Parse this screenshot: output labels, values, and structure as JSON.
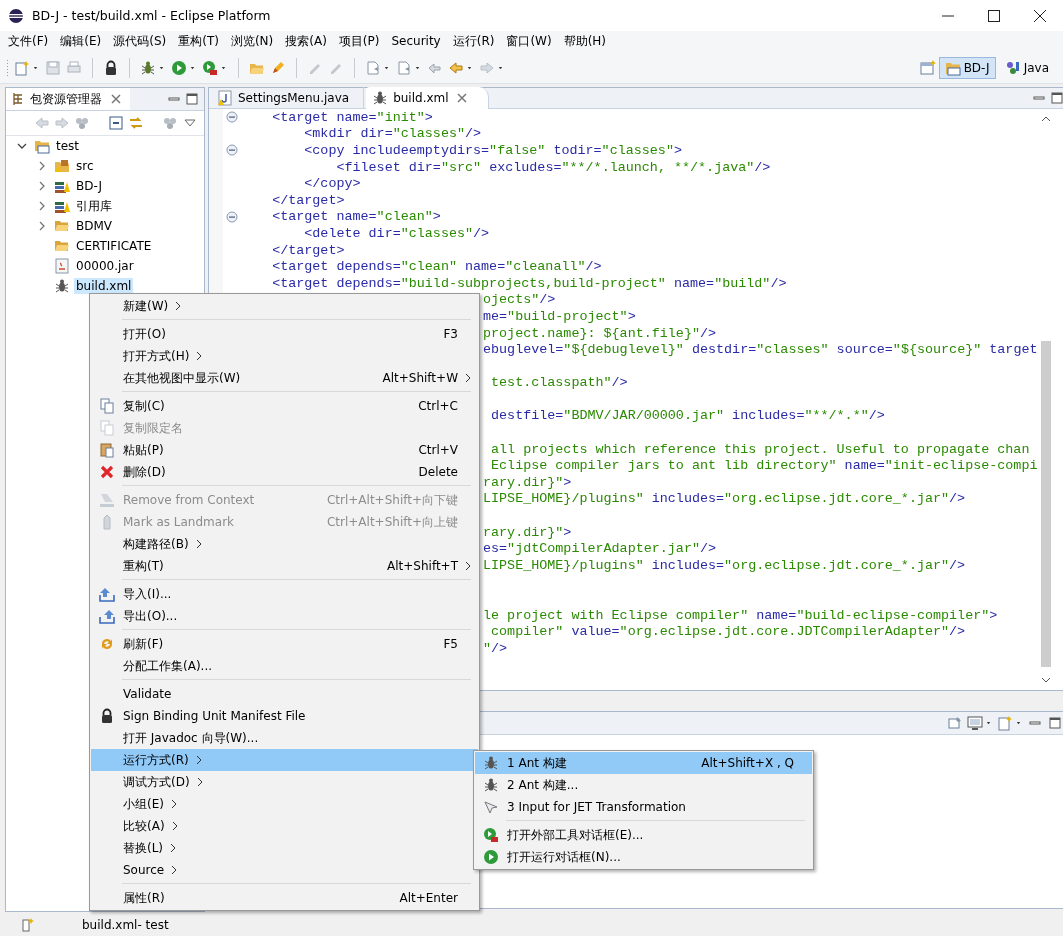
{
  "window": {
    "title": "BD-J  -  test/build.xml  -  Eclipse Platform"
  },
  "menubar": [
    "文件(F)",
    "编辑(E)",
    "源代码(S)",
    "重构(T)",
    "浏览(N)",
    "搜索(A)",
    "项目(P)",
    "Security",
    "运行(R)",
    "窗口(W)",
    "帮助(H)"
  ],
  "perspectives": [
    {
      "label": "BD-J",
      "selected": true
    },
    {
      "label": "Java",
      "selected": false
    }
  ],
  "explorer": {
    "title": "包资源管理器",
    "tree": [
      {
        "label": "test",
        "kind": "project",
        "expanded": true,
        "selected": false,
        "children": [
          {
            "label": "src",
            "kind": "source",
            "expanded": false,
            "selected": false
          },
          {
            "label": "BD-J",
            "kind": "library",
            "expanded": false,
            "selected": false
          },
          {
            "label": "引用库",
            "kind": "library",
            "expanded": false,
            "selected": false
          },
          {
            "label": "BDMV",
            "kind": "folder",
            "expanded": false,
            "selected": false
          },
          {
            "label": "CERTIFICATE",
            "kind": "folder",
            "selected": false
          },
          {
            "label": "00000.jar",
            "kind": "jar",
            "selected": false
          },
          {
            "label": "build.xml",
            "kind": "xml",
            "selected": true
          }
        ]
      }
    ]
  },
  "editor": {
    "tabs": [
      {
        "label": "SettingsMenu.java",
        "kind": "java",
        "selected": false
      },
      {
        "label": "build.xml",
        "kind": "xml",
        "selected": true
      }
    ],
    "lines": [
      {
        "kind": "full",
        "collapsible": true,
        "segments": [
          {
            "kind": "markup",
            "text": "    <target name="
          },
          {
            "kind": "value",
            "text": "\"init\""
          },
          {
            "kind": "markup",
            "text": ">"
          }
        ]
      },
      {
        "kind": "full",
        "segments": [
          {
            "kind": "markup",
            "text": "        <mkdir dir="
          },
          {
            "kind": "value",
            "text": "\"classes\""
          },
          {
            "kind": "markup",
            "text": "/>"
          }
        ]
      },
      {
        "kind": "full",
        "collapsible": true,
        "segments": [
          {
            "kind": "markup",
            "text": "        <copy includeemptydirs="
          },
          {
            "kind": "value",
            "text": "\"false\""
          },
          {
            "kind": "markup",
            "text": " todir="
          },
          {
            "kind": "value",
            "text": "\"classes\""
          },
          {
            "kind": "markup",
            "text": ">"
          }
        ]
      },
      {
        "kind": "full",
        "segments": [
          {
            "kind": "markup",
            "text": "            <fileset dir="
          },
          {
            "kind": "value",
            "text": "\"src\""
          },
          {
            "kind": "markup",
            "text": " excludes="
          },
          {
            "kind": "value",
            "text": "\"**/*.launch, **/*.java\""
          },
          {
            "kind": "markup",
            "text": "/>"
          }
        ]
      },
      {
        "kind": "full",
        "segments": [
          {
            "kind": "markup",
            "text": "        </copy>"
          }
        ]
      },
      {
        "kind": "full",
        "segments": [
          {
            "kind": "markup",
            "text": "    </target>"
          }
        ]
      },
      {
        "kind": "full",
        "collapsible": true,
        "segments": [
          {
            "kind": "markup",
            "text": "    <target name="
          },
          {
            "kind": "value",
            "text": "\"clean\""
          },
          {
            "kind": "markup",
            "text": ">"
          }
        ]
      },
      {
        "kind": "full",
        "segments": [
          {
            "kind": "markup",
            "text": "        <delete dir="
          },
          {
            "kind": "value",
            "text": "\"classes\""
          },
          {
            "kind": "markup",
            "text": "/>"
          }
        ]
      },
      {
        "kind": "full",
        "segments": [
          {
            "kind": "markup",
            "text": "    </target>"
          }
        ]
      },
      {
        "kind": "full",
        "segments": [
          {
            "kind": "markup",
            "text": "    <target depends="
          },
          {
            "kind": "value",
            "text": "\"clean\""
          },
          {
            "kind": "markup",
            "text": " name="
          },
          {
            "kind": "value",
            "text": "\"cleanall\""
          },
          {
            "kind": "markup",
            "text": "/>"
          }
        ]
      },
      {
        "kind": "full",
        "segments": [
          {
            "kind": "markup",
            "text": "    <target depends="
          },
          {
            "kind": "value",
            "text": "\"build-subprojects,build-project\""
          },
          {
            "kind": "markup",
            "text": " name="
          },
          {
            "kind": "value",
            "text": "\"build\""
          },
          {
            "kind": "markup",
            "text": "/>"
          }
        ]
      },
      {
        "kind": "fragment",
        "segments": [
          {
            "kind": "value",
            "text": "ojects\""
          },
          {
            "kind": "markup",
            "text": "/>"
          }
        ]
      },
      {
        "kind": "fragment",
        "segments": [
          {
            "kind": "markup",
            "text": "me="
          },
          {
            "kind": "value",
            "text": "\"build-project\""
          },
          {
            "kind": "markup",
            "text": ">"
          }
        ]
      },
      {
        "kind": "fragment",
        "segments": [
          {
            "kind": "value",
            "text": "project.name}: ${ant.file}\""
          },
          {
            "kind": "markup",
            "text": "/>"
          }
        ]
      },
      {
        "kind": "fragment",
        "segments": [
          {
            "kind": "markup",
            "text": "ebuglevel="
          },
          {
            "kind": "value",
            "text": "\"${debuglevel}\""
          },
          {
            "kind": "markup",
            "text": " destdir="
          },
          {
            "kind": "value",
            "text": "\"classes\""
          },
          {
            "kind": "markup",
            "text": " source="
          },
          {
            "kind": "value",
            "text": "\"${source}\""
          },
          {
            "kind": "markup",
            "text": " target"
          }
        ]
      },
      {
        "kind": "blank"
      },
      {
        "kind": "fragment",
        "segments": [
          {
            "kind": "value",
            "text": " test.classpath\""
          },
          {
            "kind": "markup",
            "text": "/>"
          }
        ]
      },
      {
        "kind": "blank"
      },
      {
        "kind": "fragment",
        "segments": [
          {
            "kind": "markup",
            "text": " destfile="
          },
          {
            "kind": "value",
            "text": "\"BDMV/JAR/00000.jar\""
          },
          {
            "kind": "markup",
            "text": " includes="
          },
          {
            "kind": "value",
            "text": "\"**/*.*\""
          },
          {
            "kind": "markup",
            "text": "/>"
          }
        ]
      },
      {
        "kind": "blank"
      },
      {
        "kind": "fragment",
        "segments": [
          {
            "kind": "value",
            "text": " all projects which reference this project. Useful to propagate chan"
          }
        ]
      },
      {
        "kind": "fragment",
        "segments": [
          {
            "kind": "value",
            "text": " Eclipse compiler jars to ant lib directory\""
          },
          {
            "kind": "markup",
            "text": " name="
          },
          {
            "kind": "value",
            "text": "\"init-eclipse-compi"
          }
        ]
      },
      {
        "kind": "fragment",
        "segments": [
          {
            "kind": "value",
            "text": "rary.dir}\""
          },
          {
            "kind": "markup",
            "text": ">"
          }
        ]
      },
      {
        "kind": "fragment",
        "segments": [
          {
            "kind": "value",
            "text": "LIPSE_HOME}/plugins\""
          },
          {
            "kind": "markup",
            "text": " includes="
          },
          {
            "kind": "value",
            "text": "\"org.eclipse.jdt.core_*.jar\""
          },
          {
            "kind": "markup",
            "text": "/>"
          }
        ]
      },
      {
        "kind": "blank"
      },
      {
        "kind": "fragment",
        "segments": [
          {
            "kind": "value",
            "text": "rary.dir}\""
          },
          {
            "kind": "markup",
            "text": ">"
          }
        ]
      },
      {
        "kind": "fragment",
        "segments": [
          {
            "kind": "markup",
            "text": "es="
          },
          {
            "kind": "value",
            "text": "\"jdtCompilerAdapter.jar\""
          },
          {
            "kind": "markup",
            "text": "/>"
          }
        ]
      },
      {
        "kind": "fragment",
        "segments": [
          {
            "kind": "value",
            "text": "LIPSE_HOME}/plugins\""
          },
          {
            "kind": "markup",
            "text": " includes="
          },
          {
            "kind": "value",
            "text": "\"org.eclipse.jdt.core_*.jar\""
          },
          {
            "kind": "markup",
            "text": "/>"
          }
        ]
      },
      {
        "kind": "blank"
      },
      {
        "kind": "blank"
      },
      {
        "kind": "fragment",
        "segments": [
          {
            "kind": "value",
            "text": "le project with Eclipse compiler\""
          },
          {
            "kind": "markup",
            "text": " name="
          },
          {
            "kind": "value",
            "text": "\"build-eclipse-compiler\""
          },
          {
            "kind": "markup",
            "text": ">"
          }
        ]
      },
      {
        "kind": "fragment",
        "segments": [
          {
            "kind": "value",
            "text": " compiler\""
          },
          {
            "kind": "markup",
            "text": " value="
          },
          {
            "kind": "value",
            "text": "\"org.eclipse.jdt.core.JDTCompilerAdapter\""
          },
          {
            "kind": "markup",
            "text": "/>"
          }
        ]
      },
      {
        "kind": "fragment",
        "segments": [
          {
            "kind": "value",
            "text": "\""
          },
          {
            "kind": "markup",
            "text": "/>"
          }
        ]
      }
    ]
  },
  "context_menu": {
    "groups": [
      [
        {
          "label": "新建(W)",
          "submenu": true,
          "disabled": false,
          "selected": false
        }
      ],
      [
        {
          "label": "打开(O)",
          "shortcut": "F3",
          "submenu": false,
          "disabled": false,
          "selected": false
        },
        {
          "label": "打开方式(H)",
          "submenu": true,
          "disabled": false,
          "selected": false
        },
        {
          "label": "在其他视图中显示(W)",
          "shortcut": "Alt+Shift+W",
          "submenu": true,
          "disabled": false,
          "selected": false
        }
      ],
      [
        {
          "label": "复制(C)",
          "shortcut": "Ctrl+C",
          "submenu": false,
          "disabled": false,
          "selected": false
        },
        {
          "label": "复制限定名",
          "submenu": false,
          "disabled": true,
          "selected": false
        },
        {
          "label": "粘贴(P)",
          "shortcut": "Ctrl+V",
          "submenu": false,
          "disabled": false,
          "selected": false
        },
        {
          "label": "删除(D)",
          "shortcut": "Delete",
          "submenu": false,
          "disabled": false,
          "selected": false
        }
      ],
      [
        {
          "label": "Remove from Context",
          "shortcut": "Ctrl+Alt+Shift+向下键",
          "submenu": false,
          "disabled": true,
          "selected": false
        },
        {
          "label": "Mark as Landmark",
          "shortcut": "Ctrl+Alt+Shift+向上键",
          "submenu": false,
          "disabled": true,
          "selected": false
        },
        {
          "label": "构建路径(B)",
          "submenu": true,
          "disabled": false,
          "selected": false
        },
        {
          "label": "重构(T)",
          "shortcut": "Alt+Shift+T",
          "submenu": true,
          "disabled": false,
          "selected": false
        }
      ],
      [
        {
          "label": "导入(I)...",
          "submenu": false,
          "disabled": false,
          "selected": false
        },
        {
          "label": "导出(O)...",
          "submenu": false,
          "disabled": false,
          "selected": false
        }
      ],
      [
        {
          "label": "刷新(F)",
          "shortcut": "F5",
          "submenu": false,
          "disabled": false,
          "selected": false
        },
        {
          "label": "分配工作集(A)...",
          "submenu": false,
          "disabled": false,
          "selected": false
        }
      ],
      [
        {
          "label": "Validate",
          "submenu": false,
          "disabled": false,
          "selected": false
        },
        {
          "label": "Sign Binding Unit Manifest File",
          "submenu": false,
          "disabled": false,
          "selected": false
        },
        {
          "label": "打开 Javadoc 向导(W)...",
          "submenu": false,
          "disabled": false,
          "selected": false
        },
        {
          "label": "运行方式(R)",
          "submenu": true,
          "disabled": false,
          "selected": true
        },
        {
          "label": "调试方式(D)",
          "submenu": true,
          "disabled": false,
          "selected": false
        },
        {
          "label": "小组(E)",
          "submenu": true,
          "disabled": false,
          "selected": false
        },
        {
          "label": "比较(A)",
          "submenu": true,
          "disabled": false,
          "selected": false
        },
        {
          "label": "替换(L)",
          "submenu": true,
          "disabled": false,
          "selected": false
        },
        {
          "label": "Source",
          "submenu": true,
          "disabled": false,
          "selected": false
        }
      ],
      [
        {
          "label": "属性(R)",
          "shortcut": "Alt+Enter",
          "submenu": false,
          "disabled": false,
          "selected": false
        }
      ]
    ]
  },
  "submenu": {
    "groups": [
      [
        {
          "label": "1 Ant 构建",
          "shortcut": "Alt+Shift+X , Q",
          "selected": true
        },
        {
          "label": "2 Ant 构建...",
          "selected": false
        },
        {
          "label": "3 Input for JET Transformation",
          "selected": false
        }
      ],
      [
        {
          "label": "打开外部工具对话框(E)...",
          "selected": false
        },
        {
          "label": "打开运行对话框(N)...",
          "selected": false
        }
      ]
    ]
  },
  "status_bar": {
    "text": "build.xml- test"
  }
}
